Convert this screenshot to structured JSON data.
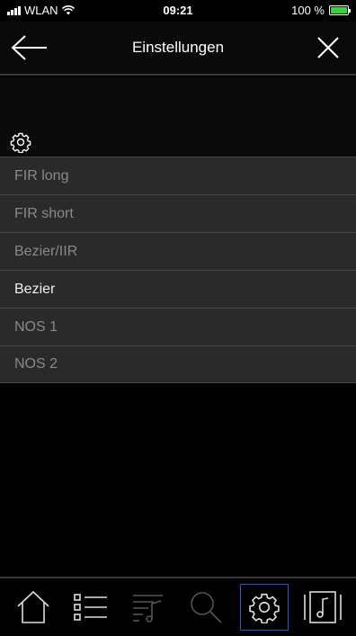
{
  "status_bar": {
    "carrier": "WLAN",
    "time": "09:21",
    "battery": "100 %"
  },
  "header": {
    "title": "Einstellungen"
  },
  "filters": {
    "items": [
      {
        "label": "FIR long"
      },
      {
        "label": "FIR short"
      },
      {
        "label": "Bezier/IIR"
      },
      {
        "label": "Bezier"
      },
      {
        "label": "NOS 1"
      },
      {
        "label": "NOS 2"
      }
    ],
    "selected": "Bezier"
  },
  "tab_bar": {
    "tabs": [
      {
        "icon": "home-icon"
      },
      {
        "icon": "list-icon"
      },
      {
        "icon": "playlist-icon"
      },
      {
        "icon": "search-icon"
      },
      {
        "icon": "gear-icon",
        "active": true
      },
      {
        "icon": "now-playing-icon"
      }
    ]
  },
  "colors": {
    "accent": "#2a55d6",
    "battery": "#3ad13a",
    "item_bg": "#2a2a2a",
    "item_text_inactive": "#8a8a8a"
  }
}
